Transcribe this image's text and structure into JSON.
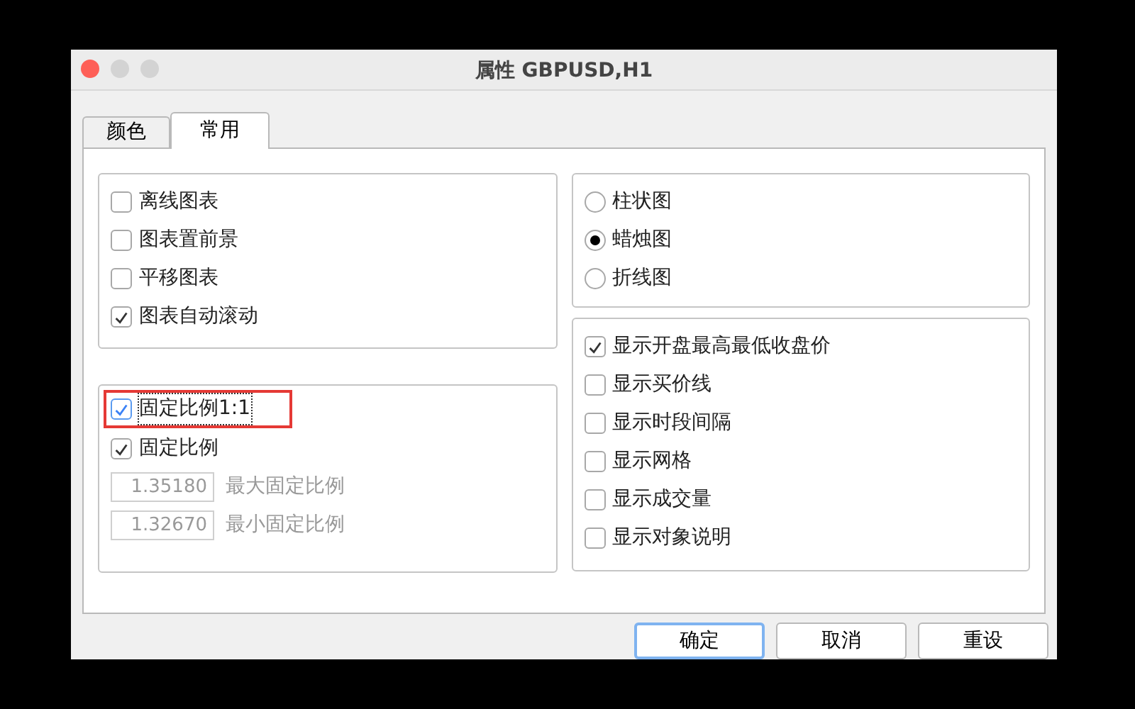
{
  "window": {
    "title": "属性 GBPUSD,H1"
  },
  "tabs": [
    {
      "label": "颜色",
      "selected": false
    },
    {
      "label": "常用",
      "selected": true
    }
  ],
  "chart_options": [
    {
      "label": "离线图表",
      "checked": false
    },
    {
      "label": "图表置前景",
      "checked": false
    },
    {
      "label": "平移图表",
      "checked": false
    },
    {
      "label": "图表自动滚动",
      "checked": true
    }
  ],
  "scale_options": [
    {
      "kind": "checkbox",
      "label": "固定比例1:1",
      "checked": true,
      "highlighted": true
    },
    {
      "kind": "checkbox",
      "label": "固定比例",
      "checked": true,
      "highlighted": false
    },
    {
      "kind": "field",
      "value": "1.35180",
      "label": "最大固定比例",
      "disabled": true
    },
    {
      "kind": "field",
      "value": "1.32670",
      "label": "最小固定比例",
      "disabled": true
    }
  ],
  "chart_type": [
    {
      "label": "柱状图",
      "selected": false
    },
    {
      "label": "蜡烛图",
      "selected": true
    },
    {
      "label": "折线图",
      "selected": false
    }
  ],
  "display_options": [
    {
      "label": "显示开盘最高最低收盘价",
      "checked": true
    },
    {
      "label": "显示买价线",
      "checked": false
    },
    {
      "label": "显示时段间隔",
      "checked": false
    },
    {
      "label": "显示网格",
      "checked": false
    },
    {
      "label": "显示成交量",
      "checked": false
    },
    {
      "label": "显示对象说明",
      "checked": false
    }
  ],
  "buttons": [
    {
      "label": "确定",
      "default": true
    },
    {
      "label": "取消",
      "default": false
    },
    {
      "label": "重设",
      "default": false
    }
  ]
}
